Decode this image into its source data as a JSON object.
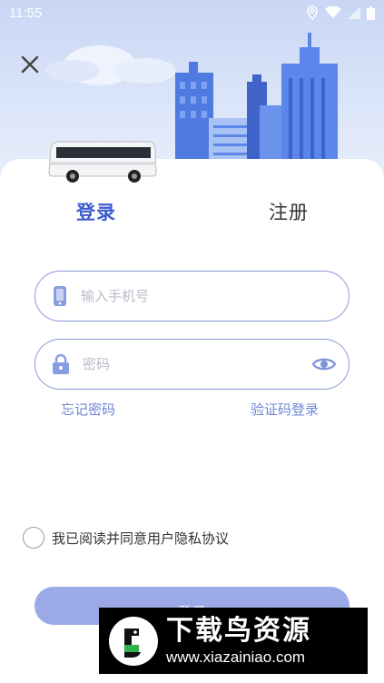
{
  "status_bar": {
    "time": "11:55"
  },
  "tabs": {
    "login": "登录",
    "register": "注册"
  },
  "form": {
    "phone_placeholder": "输入手机号",
    "password_placeholder": "密码"
  },
  "links": {
    "forgot_password": "忘记密码",
    "code_login": "验证码登录"
  },
  "agreement": {
    "text": "我已阅读并同意用户隐私协议"
  },
  "login_button": {
    "label": "登录"
  },
  "watermark": {
    "title": "下载鸟资源",
    "url": "www.xiazainiao.com"
  },
  "colors": {
    "accent": "#3c5ccf",
    "button": "#9ba9e6",
    "border": "#8797d6",
    "link": "#6f86d3"
  },
  "icons": [
    "wifi-icon",
    "signal-icon",
    "battery-icon",
    "location-icon",
    "close-icon",
    "phone-icon",
    "lock-icon",
    "eye-icon",
    "bus-icon"
  ]
}
